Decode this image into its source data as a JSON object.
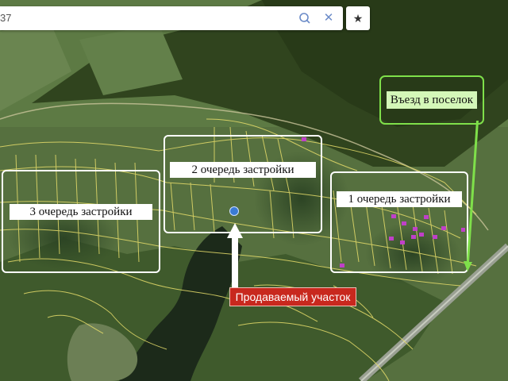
{
  "search": {
    "query": "37"
  },
  "favorite": {
    "icon": "star-icon"
  },
  "labels": {
    "entry": "Въезд в поселок",
    "stage1": "1 очередь застройки",
    "stage2": "2 очередь застройки",
    "stage3": "3 очередь застройки",
    "for_sale": "Продаваемый участок"
  },
  "colors": {
    "entry_frame": "#7fe04a",
    "zone_frame": "#ffffff",
    "sale_label": "#c8281e",
    "plot_marker": "#3a7bd5",
    "built_plots": "#c040c8"
  }
}
